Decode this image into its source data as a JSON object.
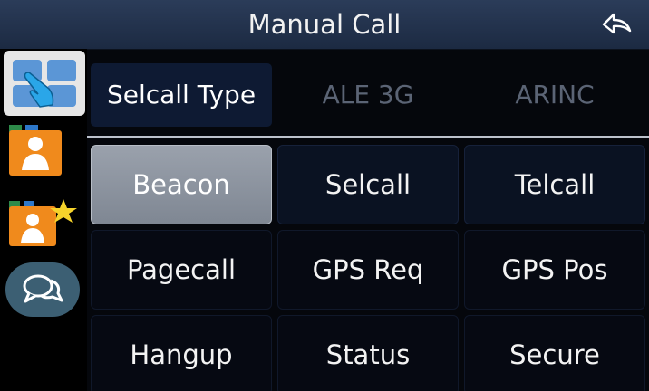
{
  "header": {
    "title": "Manual Call",
    "back_icon": "back-arrow-icon"
  },
  "sidebar": {
    "items": [
      {
        "name": "touch-select-icon",
        "active": true
      },
      {
        "name": "contact-icon",
        "active": false
      },
      {
        "name": "favorite-contact-icon",
        "active": false
      },
      {
        "name": "chat-bubbles-icon",
        "active": false
      }
    ]
  },
  "call_types": {
    "selected": "Selcall Type",
    "tabs": [
      {
        "label": "Selcall Type",
        "active": true
      },
      {
        "label": "ALE 3G",
        "active": false
      },
      {
        "label": "ARINC",
        "active": false
      }
    ]
  },
  "calls": {
    "selected": "Beacon",
    "items": [
      {
        "label": "Beacon"
      },
      {
        "label": "Selcall"
      },
      {
        "label": "Telcall"
      },
      {
        "label": "Pagecall"
      },
      {
        "label": "GPS Req"
      },
      {
        "label": "GPS Pos"
      },
      {
        "label": "Hangup"
      },
      {
        "label": "Status"
      },
      {
        "label": "Secure"
      }
    ]
  },
  "colors": {
    "titlebar": "#24344f",
    "selected_cell": "#8c939e",
    "active_tab": "#0e1a33",
    "orange": "#f08a1c",
    "teal": "#3c5f73"
  }
}
